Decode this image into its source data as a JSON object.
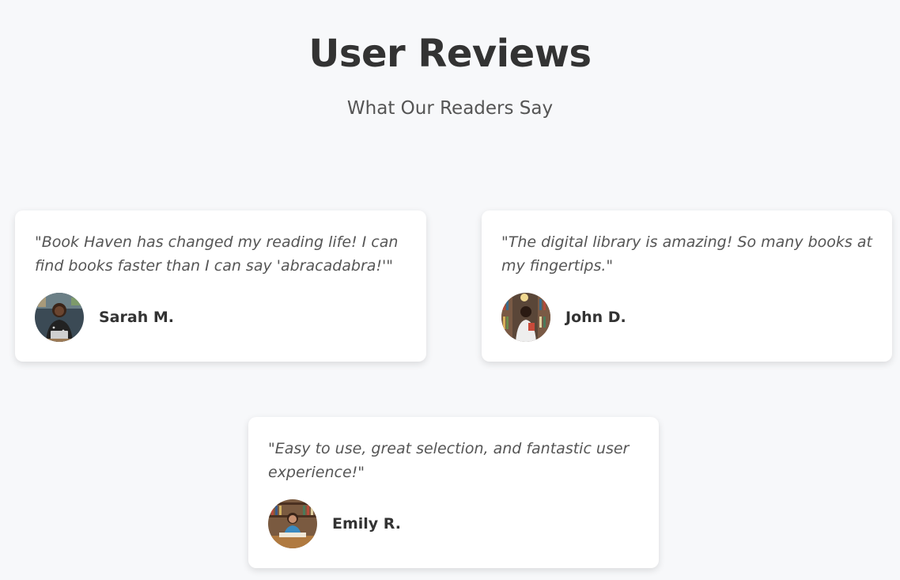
{
  "header": {
    "title": "User Reviews",
    "subtitle": "What Our Readers Say"
  },
  "reviews": [
    {
      "quote": "\"Book Haven has changed my reading life! I can find books faster than I can say 'abracadabra!'\"",
      "author": "Sarah M.",
      "avatar_icon": "avatar-photo-laptop"
    },
    {
      "quote": "\"The digital library is amazing! So many books at my fingertips.\"",
      "author": "John D.",
      "avatar_icon": "avatar-photo-library"
    },
    {
      "quote": "\"Easy to use, great selection, and fantastic user experience!\"",
      "author": "Emily R.",
      "avatar_icon": "avatar-photo-bookshelf"
    }
  ],
  "colors": {
    "background": "#f7f8fa",
    "card": "#ffffff",
    "title": "#333333",
    "quote_text": "#555555"
  }
}
